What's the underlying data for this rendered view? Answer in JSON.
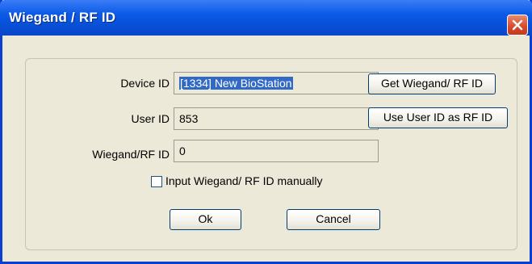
{
  "window": {
    "title": "Wiegand / RF ID",
    "accent_color": "#0a5ae6",
    "close_icon": "close-icon"
  },
  "form": {
    "device_id": {
      "label": "Device ID",
      "value": "[1334] New BioStation"
    },
    "user_id": {
      "label": "User ID",
      "value": "853"
    },
    "wiegand_rf_id": {
      "label": "Wiegand/RF ID",
      "value": "0"
    },
    "manual_checkbox": {
      "label": "Input Wiegand/ RF ID manually",
      "checked": false
    }
  },
  "buttons": {
    "get_wiegand": "Get Wiegand/ RF ID",
    "use_user_id": "Use User ID as RF ID",
    "ok": "Ok",
    "cancel": "Cancel"
  }
}
